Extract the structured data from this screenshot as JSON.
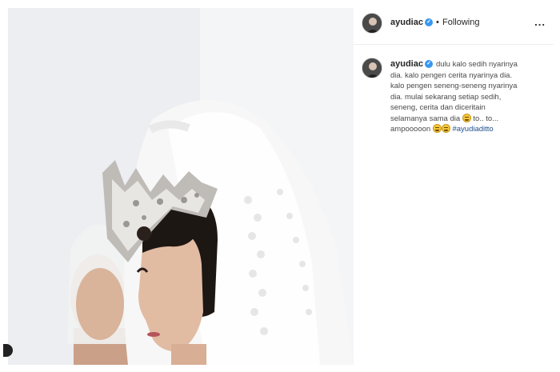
{
  "post": {
    "photo_icon": "photo-wedding-veil"
  },
  "header": {
    "username": "ayudiac",
    "verified_icon": "verified-badge-icon",
    "separator": "•",
    "follow_status": "Following",
    "more_label": "..."
  },
  "caption": {
    "username": "ayudiac",
    "lines": [
      "dulu kalo sedih nyarinya",
      "dia. kalo pengen cerita nyarinya dia.",
      "kalo pengen seneng-seneng nyarinya",
      "dia. mulai sekarang setiap sedih,",
      "seneng, cerita dan diceritain",
      "selamanya sama dia",
      "to.. to...",
      "ampooooon",
      "#ayudiaditto"
    ]
  },
  "colors": {
    "link": "#1f4f8c",
    "verified": "#3897f0",
    "text": "#262626"
  }
}
